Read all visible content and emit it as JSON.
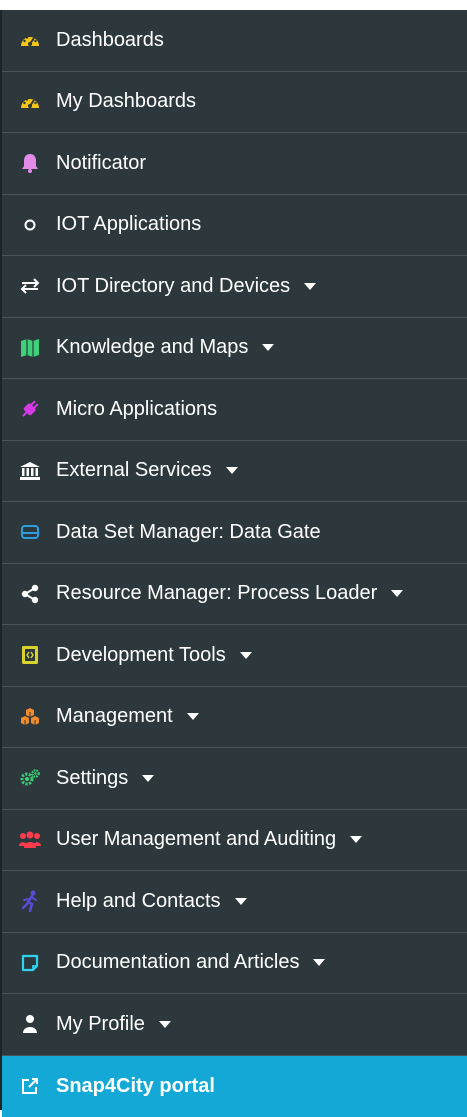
{
  "colors": {
    "sidebar_bg": "#2c383c",
    "active_bg": "#14a8d6",
    "text": "#ffffff"
  },
  "menu": {
    "items": [
      {
        "label": "Dashboards",
        "icon": "dashboard-gauge-icon"
      },
      {
        "label": "My Dashboards",
        "icon": "dashboard-gauge-icon"
      },
      {
        "label": "Notificator",
        "icon": "bell-icon"
      },
      {
        "label": "IOT Applications",
        "icon": "circle-icon"
      },
      {
        "label": "IOT Directory and Devices",
        "icon": "exchange-arrows-icon",
        "has_dropdown": true
      },
      {
        "label": "Knowledge and Maps",
        "icon": "map-icon",
        "has_dropdown": true
      },
      {
        "label": "Micro Applications",
        "icon": "plug-icon"
      },
      {
        "label": "External Services",
        "icon": "bank-building-icon",
        "has_dropdown": true
      },
      {
        "label": "Data Set Manager: Data Gate",
        "icon": "hdd-drive-icon"
      },
      {
        "label": "Resource Manager: Process Loader",
        "icon": "share-nodes-icon",
        "has_dropdown": true
      },
      {
        "label": "Development Tools",
        "icon": "code-file-icon",
        "has_dropdown": true
      },
      {
        "label": "Management",
        "icon": "cubes-icon",
        "has_dropdown": true
      },
      {
        "label": "Settings",
        "icon": "cogs-icon",
        "has_dropdown": true
      },
      {
        "label": "User Management and Auditing",
        "icon": "users-icon",
        "has_dropdown": true
      },
      {
        "label": "Help and Contacts",
        "icon": "running-person-icon",
        "has_dropdown": true
      },
      {
        "label": "Documentation and Articles",
        "icon": "square-note-icon",
        "has_dropdown": true
      },
      {
        "label": "My Profile",
        "icon": "user-icon",
        "has_dropdown": true
      },
      {
        "label": "Snap4City portal",
        "icon": "external-link-icon",
        "active": true
      }
    ]
  }
}
